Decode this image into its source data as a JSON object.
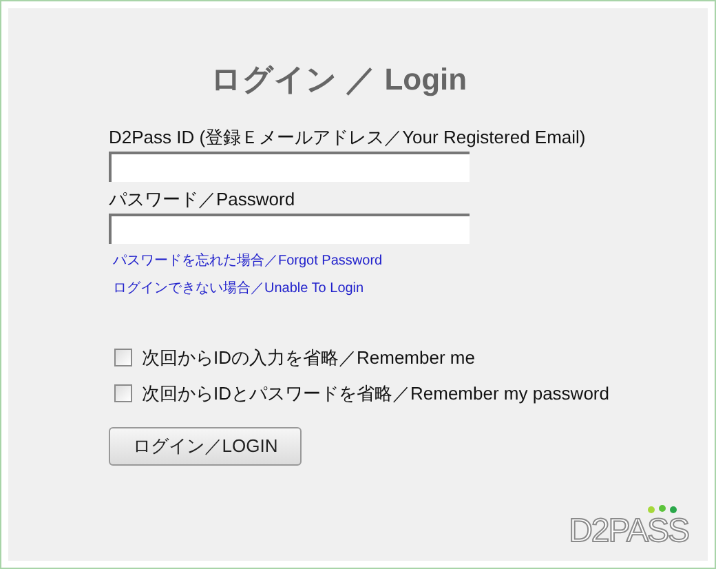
{
  "title": "ログイン ／ Login",
  "fields": [
    {
      "label": "D2Pass ID (登録Ｅメールアドレス／Your Registered Email)"
    },
    {
      "label": "パスワード／Password"
    }
  ],
  "links": [
    "パスワードを忘れた場合／Forgot Password",
    "ログインできない場合／Unable To Login"
  ],
  "options": [
    {
      "label": "次回からIDの入力を省略／Remember me",
      "checked": false
    },
    {
      "label": "次回からIDとパスワードを省略／Remember my password",
      "checked": false
    }
  ],
  "button": "ログイン／LOGIN",
  "logo": "D2PASS"
}
